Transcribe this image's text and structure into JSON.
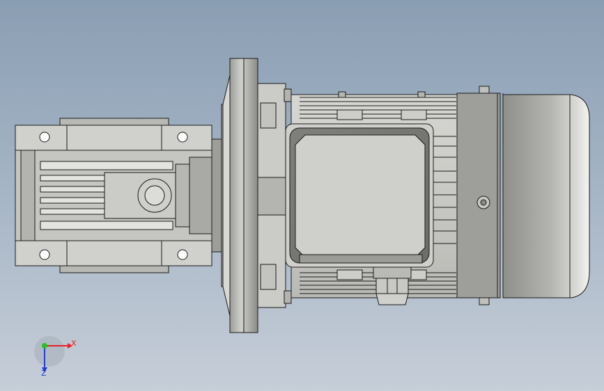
{
  "viewport": {
    "background_top": "#8a9eb3",
    "background_bottom": "#c6ced8"
  },
  "model": {
    "part_color": "#cfcfc9",
    "shade_color": "#7f807b",
    "line_color": "#1a1a1a"
  },
  "triad": {
    "x_label": "X",
    "z_label": "Z",
    "x_color": "#e8202a",
    "y_color": "#28c028",
    "z_color": "#2240d0"
  }
}
